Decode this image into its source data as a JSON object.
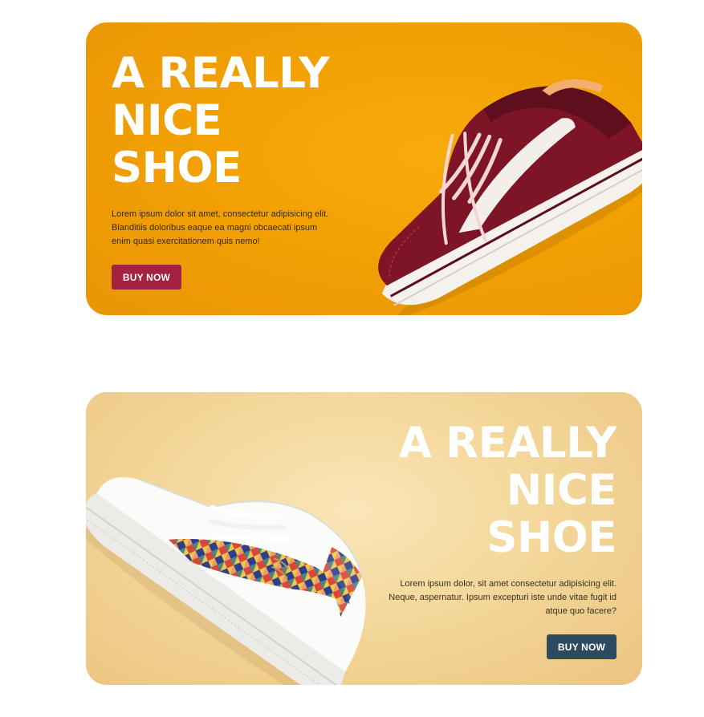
{
  "banners": [
    {
      "headline": [
        "A REALLY",
        "NICE",
        "SHOE"
      ],
      "body": "Lorem ipsum dolor sit amet, consectetur adipisicing elit. Blanditiis doloribus eaque ea magni obcaecati ipsum enim quasi exercitationem quis nemo!",
      "button_label": "BUY NOW",
      "background_color": "#f2a104",
      "button_color": "#a3203e",
      "image": "maroon-sneaker-image"
    },
    {
      "headline": [
        "A REALLY",
        "NICE",
        "SHOE"
      ],
      "body": "Lorem ipsum dolor, sit amet consectetur adipisicing elit. Neque, aspernatur. Ipsum excepturi iste unde vitae fugit id atque quo facere?",
      "button_label": "BUY NOW",
      "background_color": "#f5d99e",
      "button_color": "#2e4a5e",
      "image": "white-patterned-sneaker-image"
    }
  ]
}
